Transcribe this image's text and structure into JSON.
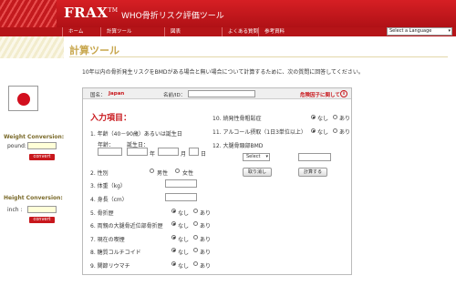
{
  "header": {
    "brand": "FRAX",
    "tm": "TM",
    "subtitle": "WHO骨折リスク評価ツール"
  },
  "nav": {
    "items": [
      "ホーム",
      "計算ツール",
      "図表",
      "よくある質問",
      "参考資料"
    ],
    "language": "Select a Language"
  },
  "page": {
    "title": "計算ツール",
    "intro": "10年以内の骨折発生リスクをBMDがある場合と無い場合について計算するために、次の質問に回答してください。"
  },
  "conversion": {
    "weight_title": "Weight Conversion:",
    "pound_label": "pound:",
    "convert_label": "convert",
    "height_title": "Height Conversion:",
    "inch_label": "inch :",
    "convert_label_2": "convert"
  },
  "form": {
    "country_label": "国名：",
    "country_value": "Japan",
    "name_label": "名前/ID：",
    "about_risk": "危険因子に関して",
    "section_title": "入力項目：",
    "q1": "1. 年齢（40－90歳）あるいは誕生日",
    "age_label": "年齢：",
    "dob_label": "誕生日：",
    "year_label": "年",
    "month_label": "月",
    "day_label": "日",
    "q2": "2. 性別",
    "male": "男性",
    "female": "女性",
    "q3": "3. 体重（kg）",
    "q4": "4. 身長（cm）",
    "q5": "5. 骨折歴",
    "q6": "6. 両親の大腿骨近位部骨折歴",
    "q7": "7. 現在の喫煙",
    "q8": "8. 糖質コルチコイド",
    "q9": "9. 関節リウマチ",
    "q10": "10. 続発性骨粗鬆症",
    "q11": "11. アルコール摂取（1日3単位以上）",
    "q12": "12. 大腿骨頸部BMD",
    "no": "なし",
    "yes": "あり",
    "select": "Select",
    "clear": "取り消し",
    "calculate": "計算する"
  },
  "colors": {
    "brand_red": "#c8171c",
    "gold": "#c8a74e"
  }
}
